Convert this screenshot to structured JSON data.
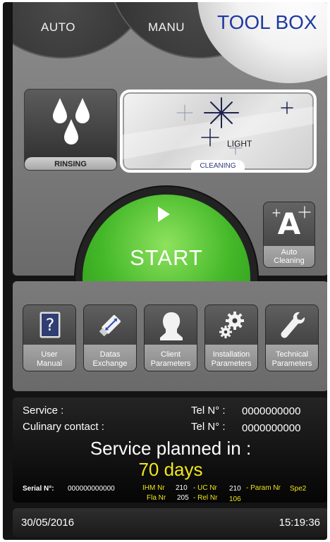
{
  "tabs": {
    "auto": "AUTO",
    "manu": "MANU",
    "toolbox": "TOOL BOX"
  },
  "modes": {
    "rinsing": "RINSING",
    "cleaning": "CLEANING",
    "cleaning_level": "LIGHT"
  },
  "start": {
    "label": "START",
    "icon": "play-icon"
  },
  "auto_cleaning": {
    "letter": "A",
    "label": "Auto\nCleaning"
  },
  "tools": [
    {
      "label": "User\nManual",
      "icon": "manual-icon"
    },
    {
      "label": "Datas\nExchange",
      "icon": "usb-key-icon"
    },
    {
      "label": "Client\nParameters",
      "icon": "person-head-icon"
    },
    {
      "label": "Installation\nParameters",
      "icon": "gears-icon"
    },
    {
      "label": "Technical\nParameters",
      "icon": "wrench-icon"
    }
  ],
  "info": {
    "service_label": "Service :",
    "service_tel_label": "Tel N° :",
    "service_tel": "0000000000",
    "culinary_label": "Culinary contact :",
    "culinary_tel_label": "Tel N° :",
    "culinary_tel": "0000000000",
    "planned_label": "Service planned in :",
    "planned_value": "70 days",
    "serial_label": "Serial N°:",
    "serial_value": "000000000000",
    "ihm_label": "IHM Nr",
    "ihm_value": "210",
    "uc_label": "- UC Nr",
    "uc_value": "210",
    "param_label": "- Param Nr",
    "param_value": "Spe2",
    "fla_label": "Fla Nr",
    "fla_value": "205",
    "rel_label": "- Rel Nr",
    "rel_value": "106"
  },
  "status": {
    "date": "30/05/2016",
    "time": "15:19:36"
  },
  "colors": {
    "accent_blue": "#1f3aa0",
    "start_green": "#44b829",
    "highlight_yellow": "#f1e51d"
  }
}
